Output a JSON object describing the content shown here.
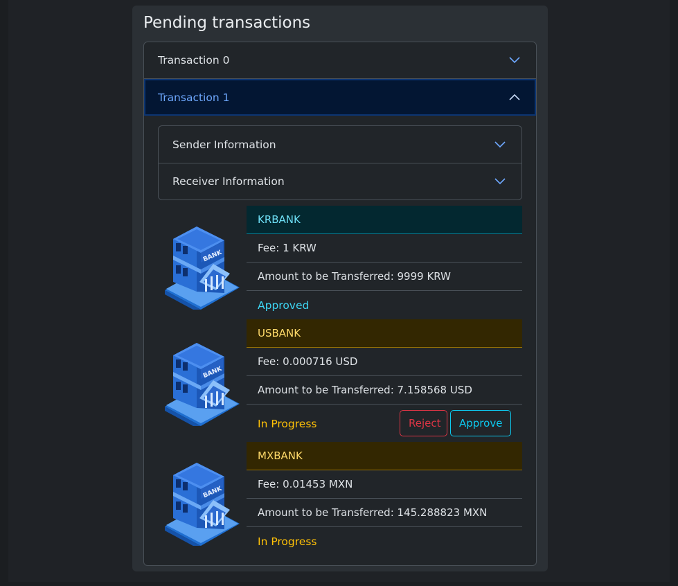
{
  "panel": {
    "title": "Pending transactions"
  },
  "transactions": [
    {
      "label": "Transaction 0"
    },
    {
      "label": "Transaction 1"
    }
  ],
  "sub_sections": {
    "sender": "Sender Information",
    "receiver": "Receiver Information"
  },
  "banks": [
    {
      "name": "KRBANK",
      "fee": "Fee: 1 KRW",
      "amount": "Amount to be Transferred: 9999 KRW",
      "status": "Approved",
      "icon": "bank-building-icon"
    },
    {
      "name": "USBANK",
      "fee": "Fee: 0.000716 USD",
      "amount": "Amount to be Transferred: 7.158568 USD",
      "status": "In Progress",
      "icon": "bank-building-icon"
    },
    {
      "name": "MXBANK",
      "fee": "Fee: 0.01453 MXN",
      "amount": "Amount to be Transferred: 145.288823 MXN",
      "status": "In Progress",
      "icon": "bank-building-icon"
    }
  ],
  "actions": {
    "reject": "Reject",
    "approve": "Approve"
  },
  "colors": {
    "approved": "#3dd5f3",
    "in_progress": "#ffc107",
    "reject": "#dc3545",
    "approve": "#0dcaf0",
    "active_header": "#6ea8fe"
  }
}
